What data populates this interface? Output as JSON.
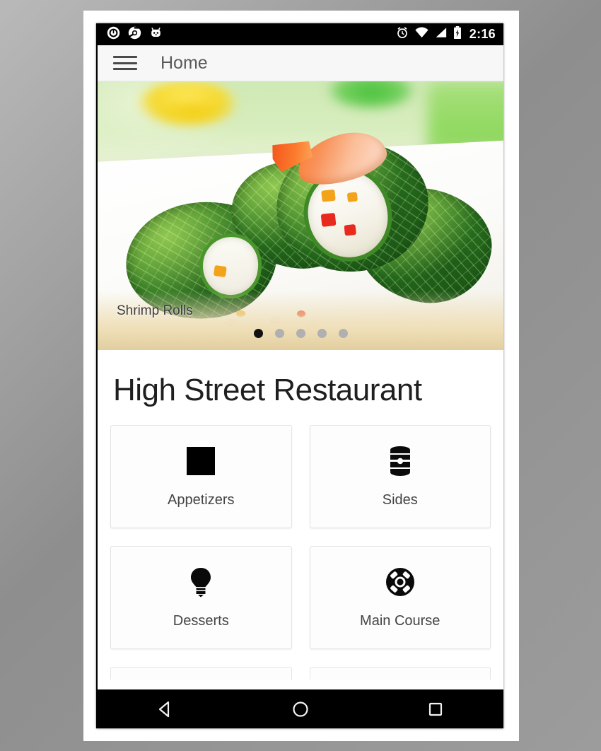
{
  "status_bar": {
    "time": "2:16",
    "left_icons": [
      "power-circle-icon",
      "chrome-icon",
      "android-robot-icon"
    ],
    "right_icons": [
      "alarm-clock-icon",
      "wifi-icon",
      "cellular-signal-icon",
      "battery-charging-icon"
    ]
  },
  "app_bar": {
    "menu_icon": "hamburger-menu-icon",
    "title": "Home"
  },
  "hero": {
    "caption": "Shrimp Rolls",
    "total_slides": 5,
    "active_slide": 1,
    "image_alt": "Shrimp cabbage rolls on a white plate"
  },
  "content": {
    "restaurant_name": "High Street Restaurant",
    "categories": [
      {
        "label": "Appetizers",
        "icon": "black-square-placeholder-icon"
      },
      {
        "label": "Sides",
        "icon": "barrel-icon"
      },
      {
        "label": "Desserts",
        "icon": "lightbulb-icon"
      },
      {
        "label": "Main Course",
        "icon": "lifebuoy-icon"
      }
    ]
  },
  "nav_bar": {
    "back_label": "back-triangle-icon",
    "home_label": "home-circle-icon",
    "recents_label": "recents-square-icon"
  },
  "colors": {
    "status_bar_bg": "#000000",
    "app_bar_bg": "#f7f7f7",
    "page_bg": "#ffffff",
    "accent_dot_active": "#111111",
    "accent_dot_inactive": "#b0b0b0",
    "text_primary": "#1f1f1f",
    "text_secondary": "#5a5a5a"
  }
}
